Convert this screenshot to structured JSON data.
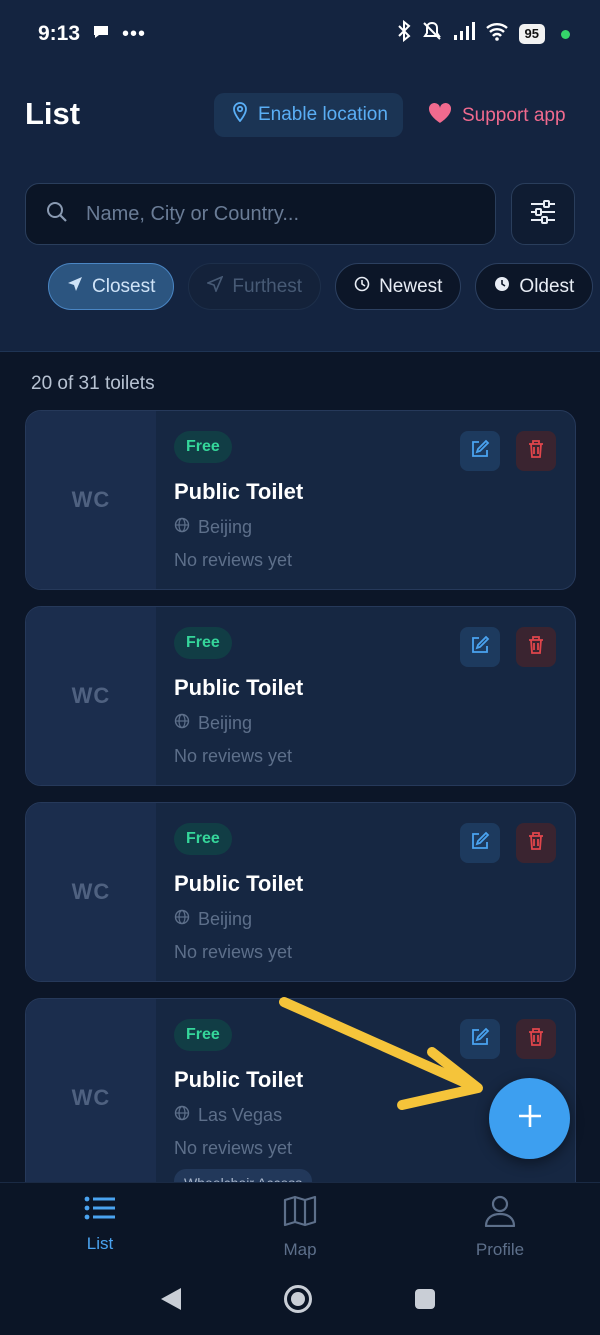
{
  "status_bar": {
    "time": "9:13",
    "battery": "95"
  },
  "header": {
    "title": "List",
    "enable_location_label": "Enable location",
    "support_label": "Support app"
  },
  "search": {
    "placeholder": "Name, City or Country..."
  },
  "sort_chips": [
    {
      "label": "Closest",
      "state": "active"
    },
    {
      "label": "Furthest",
      "state": "disabled"
    },
    {
      "label": "Newest",
      "state": "normal"
    },
    {
      "label": "Oldest",
      "state": "normal"
    }
  ],
  "result_count": "20 of 31 toilets",
  "cards": [
    {
      "thumb": "WC",
      "badge": "Free",
      "title": "Public Toilet",
      "city": "Beijing",
      "reviews": "No reviews yet"
    },
    {
      "thumb": "WC",
      "badge": "Free",
      "title": "Public Toilet",
      "city": "Beijing",
      "reviews": "No reviews yet"
    },
    {
      "thumb": "WC",
      "badge": "Free",
      "title": "Public Toilet",
      "city": "Beijing",
      "reviews": "No reviews yet"
    },
    {
      "thumb": "WC",
      "badge": "Free",
      "title": "Public Toilet",
      "city": "Las Vegas",
      "reviews": "No reviews yet",
      "tag": "Wheelchair Access"
    }
  ],
  "bottom_nav": [
    {
      "label": "List",
      "icon": "list-icon",
      "active": true
    },
    {
      "label": "Map",
      "icon": "map-icon",
      "active": false
    },
    {
      "label": "Profile",
      "icon": "person-icon",
      "active": false
    }
  ],
  "colors": {
    "accent": "#4aa3f0",
    "badge_free": "#35d69a",
    "support": "#f06a8e",
    "delete": "#e0454b",
    "annotation_arrow": "#f5c43a"
  }
}
